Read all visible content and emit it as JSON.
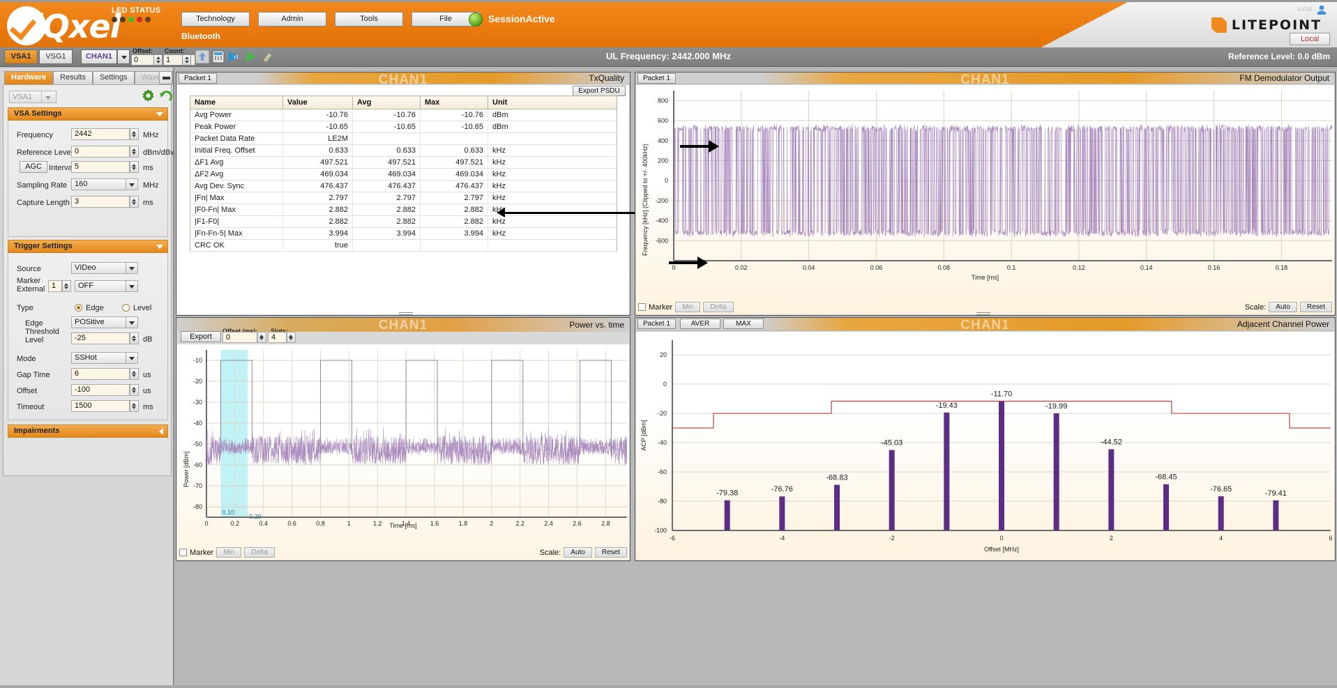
{
  "banner": {
    "logo_text": "iQxel",
    "led_status_label": "LED STATUS",
    "leds": [
      "#5a3a12",
      "#5a3a12",
      "#43c020",
      "#d03020",
      "#6a4018"
    ],
    "menu": [
      "Technology",
      "Admin",
      "Tools",
      "File"
    ],
    "technology_label": "Bluetooth",
    "session_status": "SessionActive",
    "brand": "LITEPOINT",
    "brand_ghost": "local",
    "local_button": "Local"
  },
  "toolbar": {
    "vsa_tab": "VSA1",
    "vsg_tab": "VSG1",
    "chan_tab": "CHAN1",
    "offset_label": "Offset:",
    "offset_value": "0",
    "count_label": "Count:",
    "count_value": "1",
    "ul_frequency": "UL Frequency: 2442.000 MHz",
    "reference_level": "Reference Level: 0.0 dBm"
  },
  "sidebar": {
    "tabs": [
      {
        "label": "Hardware",
        "state": "active"
      },
      {
        "label": "Results",
        "state": "normal"
      },
      {
        "label": "Settings",
        "state": "normal"
      },
      {
        "label": "Wave Gen",
        "state": "disabled"
      }
    ],
    "instrument_select": "VSA1",
    "vsa_settings": {
      "title": "VSA Settings",
      "fields": [
        {
          "label": "Frequency",
          "value": "2442",
          "unit": "MHz",
          "kind": "spin"
        },
        {
          "label": "Reference Level",
          "value": "0",
          "unit": "dBm/dBv",
          "kind": "spin"
        },
        {
          "label": "Interval",
          "value": "5",
          "unit": "ms",
          "kind": "spin",
          "button": "AGC"
        },
        {
          "label": "Sampling Rate",
          "value": "160",
          "unit": "MHz",
          "kind": "combo"
        },
        {
          "label": "Capture Length",
          "value": "3",
          "unit": "ms",
          "kind": "spin"
        }
      ]
    },
    "trigger_settings": {
      "title": "Trigger Settings",
      "source_label": "Source",
      "source_value": "VIDeo",
      "marker_label": "Marker",
      "external_label": "External",
      "marker_index": "1",
      "external_value": "OFF",
      "type_label": "Type",
      "type_edge": "Edge",
      "type_level": "Level",
      "type_selected": "Edge",
      "edge_label": "Edge",
      "edge_value": "POSitive",
      "threshold_label": "Threshold",
      "level_label": "Level",
      "level_value": "-25",
      "level_unit": "dB",
      "mode_label": "Mode",
      "mode_value": "SSHot",
      "gap_label": "Gap Time",
      "gap_value": "6",
      "gap_unit": "us",
      "offset_label": "Offset",
      "offset_value": "-100",
      "offset_unit": "us",
      "timeout_label": "Timeout",
      "timeout_value": "1500",
      "timeout_unit": "ms"
    },
    "impairments_title": "Impairments"
  },
  "txquality": {
    "packet_tab": "Packet 1",
    "title": "TxQuality",
    "export_button": "Export PSDU",
    "watermark": "CHAN1",
    "columns": [
      "Name",
      "Value",
      "Avg",
      "Max",
      "Unit"
    ],
    "rows": [
      {
        "name": "Avg Power",
        "value": "-10.76",
        "avg": "-10.76",
        "max": "-10.76",
        "unit": "dBm"
      },
      {
        "name": "Peak Power",
        "value": "-10.65",
        "avg": "-10.65",
        "max": "-10.65",
        "unit": "dBm"
      },
      {
        "name": "Packet Data Rate",
        "value": "LE2M",
        "avg": "",
        "max": "",
        "unit": ""
      },
      {
        "name": "Initial Freq. Offset",
        "value": "0.633",
        "avg": "0.633",
        "max": "0.633",
        "unit": "kHz"
      },
      {
        "name": "ΔF1 Avg",
        "value": "497.521",
        "avg": "497.521",
        "max": "497.521",
        "unit": "kHz"
      },
      {
        "name": "ΔF2 Avg",
        "value": "469.034",
        "avg": "469.034",
        "max": "469.034",
        "unit": "kHz"
      },
      {
        "name": "Avg Dev. Sync",
        "value": "476.437",
        "avg": "476.437",
        "max": "476.437",
        "unit": "kHz"
      },
      {
        "name": "|Fn| Max",
        "value": "2.797",
        "avg": "2.797",
        "max": "2.797",
        "unit": "kHz"
      },
      {
        "name": "|F0-Fn| Max",
        "value": "2.882",
        "avg": "2.882",
        "max": "2.882",
        "unit": "kHz"
      },
      {
        "name": "|F1-F0|",
        "value": "2.882",
        "avg": "2.882",
        "max": "2.882",
        "unit": "kHz"
      },
      {
        "name": "|Fn-Fn-5| Max",
        "value": "3.994",
        "avg": "3.994",
        "max": "3.994",
        "unit": "kHz"
      },
      {
        "name": "CRC OK",
        "value": "true",
        "avg": "",
        "max": "",
        "unit": ""
      }
    ]
  },
  "power_vs_time": {
    "title": "Power vs. time",
    "watermark": "CHAN1",
    "export_button": "Export",
    "offset_label": "Offset (ms):",
    "offset_value": "0",
    "slots_label": "Slots:",
    "slots_value": "4",
    "marker_label": "Marker",
    "min_button": "Min",
    "delta_button": "Delta",
    "scale_label": "Scale:",
    "auto_button": "Auto",
    "reset_button": "Reset",
    "cursor_left": "0.10",
    "cursor_right": "0.29"
  },
  "fm_demod": {
    "packet_tab": "Packet 1",
    "title": "FM Demodulator Output",
    "watermark": "CHAN1",
    "marker_label": "Marker",
    "min_button": "Min",
    "delta_button": "Delta",
    "scale_label": "Scale:",
    "auto_button": "Auto",
    "reset_button": "Reset"
  },
  "acp": {
    "packet_tab": "Packet 1",
    "aver_button": "AVER",
    "max_button": "MAX",
    "title": "Adjacent Channel Power",
    "watermark": "CHAN1"
  },
  "colors": {
    "brand_orange": "#ec7c10",
    "trace_purple": "#a382b8",
    "bar_purple": "#5c2d82",
    "mask_red": "#c94c4c",
    "cursor_cyan": "#b6f0f5"
  },
  "chart_data": [
    {
      "type": "line",
      "name": "fm_demodulator_output",
      "title": "FM Demodulator Output",
      "xlabel": "Time [ms]",
      "ylabel": "Frequency [kHz] (Clipped to +/- 400kHz)",
      "xlim": [
        0,
        0.195
      ],
      "ylim": [
        -800,
        900
      ],
      "xticks": [
        "0",
        "0.02",
        "0.04",
        "0.06",
        "0.08",
        "0.1",
        "0.12",
        "0.14",
        "0.16",
        "0.18"
      ],
      "yticks": [
        "800",
        "600",
        "400",
        "200",
        "0",
        "-200",
        "-400",
        "-600"
      ],
      "grid": true,
      "series_color": "#a382b8",
      "annotations": [
        {
          "text": "arrow",
          "y": 500,
          "x": 0.012
        },
        {
          "text": "arrow",
          "y": -500,
          "x": 0.011
        }
      ],
      "description": "Dense GFSK FM demod trace oscillating between about +530 kHz and -530 kHz"
    },
    {
      "type": "bar",
      "name": "adjacent_channel_power",
      "title": "Adjacent Channel Power",
      "xlabel": "Offset [MHz]",
      "ylabel": "ACP [dBm]",
      "xlim": [
        -6,
        6
      ],
      "ylim": [
        -100,
        30
      ],
      "xticks": [
        "-6",
        "-4",
        "-2",
        "0",
        "2",
        "4",
        "6"
      ],
      "yticks": [
        "20",
        "0",
        "-20",
        "-40",
        "-60",
        "-80",
        "-100"
      ],
      "grid": true,
      "bar_color": "#5c2d82",
      "categories": [
        -5,
        -4,
        -3,
        -2,
        -1,
        0,
        1,
        2,
        3,
        4,
        5
      ],
      "values": [
        -79.38,
        -76.76,
        -68.83,
        -45.03,
        -19.43,
        -11.7,
        -19.99,
        -44.52,
        -68.45,
        -76.65,
        -79.41
      ],
      "labels": [
        "-79.38",
        "-76.76",
        "-68.83",
        "-45.03",
        "-19.43",
        "-11.70",
        "-19.99",
        "-44.52",
        "-68.45",
        "-76.65",
        "-79.41"
      ],
      "mask": {
        "color": "#c94c4c",
        "segments": [
          {
            "x0": -6,
            "x1": -5.25,
            "y": -30
          },
          {
            "x0": -5.25,
            "x1": -3.1,
            "y": -20
          },
          {
            "x0": -3.1,
            "x1": 3.1,
            "y": -11.7
          },
          {
            "x0": 3.1,
            "x1": 5.25,
            "y": -20
          },
          {
            "x0": 5.25,
            "x1": 6,
            "y": -30
          }
        ]
      }
    },
    {
      "type": "line",
      "name": "power_vs_time",
      "title": "Power vs. time",
      "xlabel": "Time [ms]",
      "ylabel": "Power [dBm]",
      "xlim": [
        0,
        2.95
      ],
      "ylim": [
        -85,
        -5
      ],
      "xticks": [
        "0",
        "0.2",
        "0.4",
        "0.6",
        "0.8",
        "1",
        "1.2",
        "1.4",
        "1.6",
        "1.8",
        "2",
        "2.2",
        "2.4",
        "2.6",
        "2.8"
      ],
      "yticks": [
        "-10",
        "-20",
        "-30",
        "-40",
        "-50",
        "-60",
        "-70",
        "-80"
      ],
      "grid": true,
      "series_color": "#a382b8",
      "bursts": [
        {
          "start": 0.1,
          "end": 0.32,
          "level": -10
        },
        {
          "start": 0.8,
          "end": 1.02,
          "level": -10
        },
        {
          "start": 1.4,
          "end": 1.62,
          "level": -10
        },
        {
          "start": 2.0,
          "end": 2.22,
          "level": -10
        },
        {
          "start": 2.62,
          "end": 2.84,
          "level": -10
        }
      ],
      "noise_floor": -55,
      "cursor_band": {
        "start": 0.1,
        "end": 0.29,
        "color": "#b6f0f5"
      }
    }
  ]
}
